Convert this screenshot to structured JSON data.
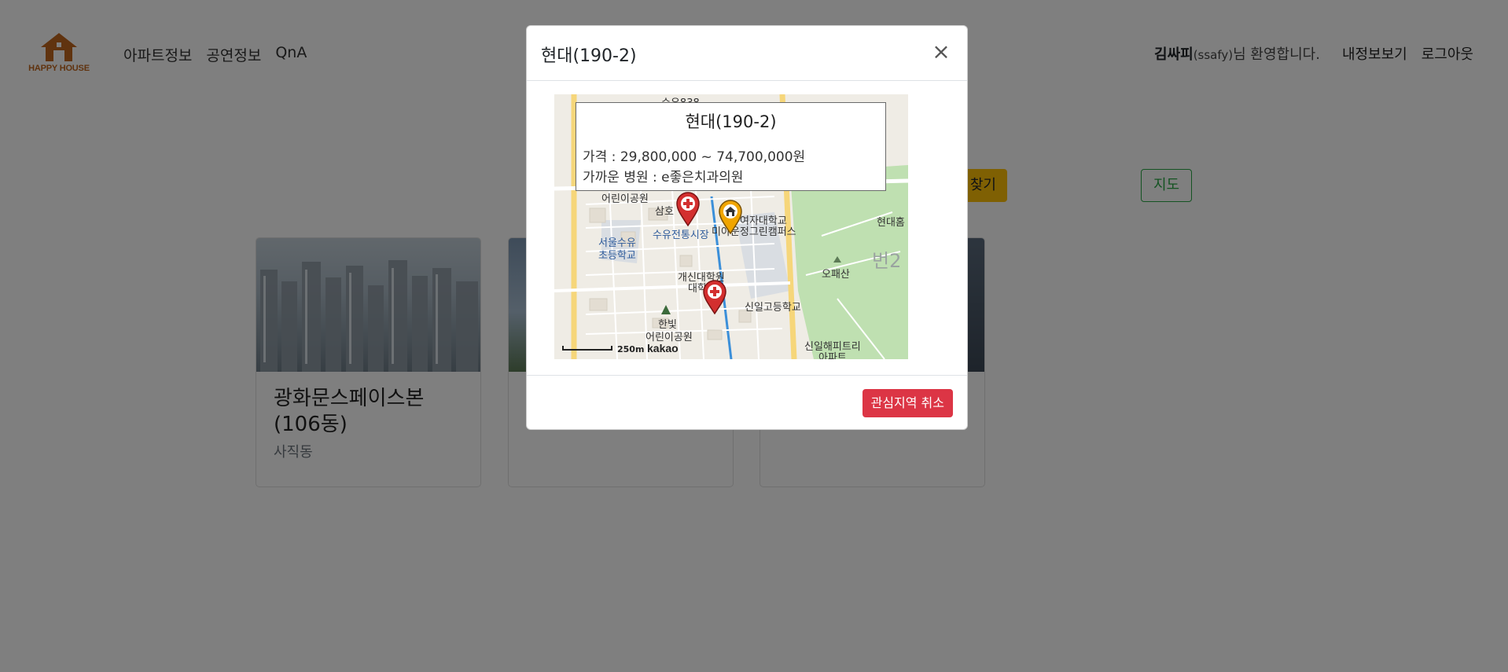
{
  "brand": {
    "logo_text": "HAPPY HOUSE",
    "color": "#c0661f"
  },
  "nav": {
    "items": [
      "아파트정보",
      "공연정보",
      "QnA"
    ]
  },
  "user": {
    "name": "김싸피",
    "id": "(ssafy)",
    "welcome": "님 환영합니다.",
    "profile_link": "내정보보기",
    "logout_link": "로그아웃"
  },
  "toolbar": {
    "search_label": "찾기",
    "map_label": "지도"
  },
  "cards": [
    {
      "title": "광화문스페이스본(106동)",
      "subtitle": "사직동"
    },
    {
      "title": "",
      "subtitle": ""
    },
    {
      "title": "",
      "subtitle": ""
    }
  ],
  "modal": {
    "title": "현대(190-2)",
    "close_icon": "×",
    "cancel_button": "관심지역 취소",
    "info": {
      "title": "현대(190-2)",
      "price": "가격 : 29,800,000 ~ 74,700,000원",
      "hospital": "가까운 병원 : e좋은치과의원"
    },
    "map": {
      "labels": [
        "어린이공원",
        "삼호",
        "수유전통시장",
        "서울수유",
        "초등학교",
        "여자대학교",
        "미아운정그린캠퍼스",
        "개신대학원",
        "대학",
        "한빛",
        "어린이공원",
        "오패산",
        "신일고등학교",
        "신일해피트리",
        "아파트",
        "현대홈",
        "수유838",
        "번2"
      ],
      "scale_text": "250m",
      "attribution": "kakao"
    }
  },
  "colors": {
    "danger": "#dc3545",
    "warning": "#ffc107",
    "success": "#28a745",
    "hospital_marker": "#d32f2f",
    "house_marker": "#f0a500"
  }
}
